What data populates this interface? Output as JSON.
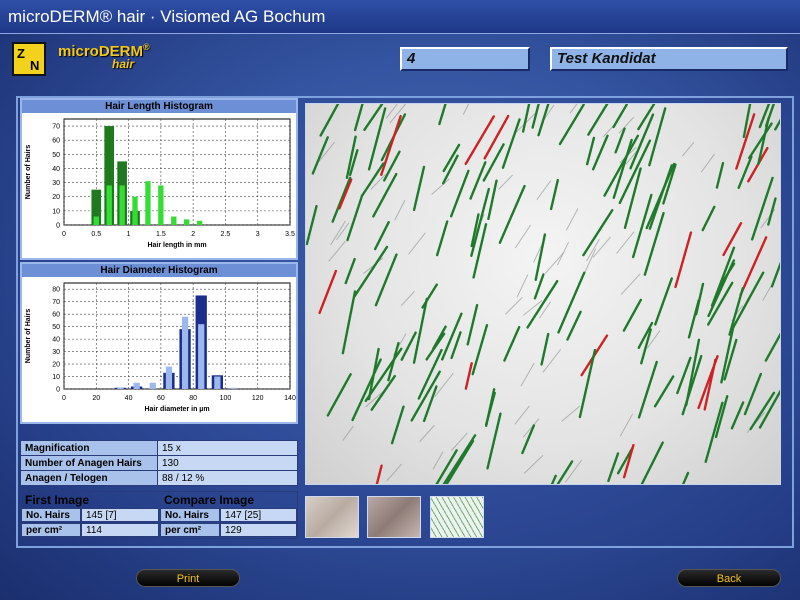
{
  "window": {
    "title": "microDERM® hair · Visiomed AG Bochum"
  },
  "logo": {
    "mark_top_left": "Z",
    "mark_bottom_right": "N",
    "name": "microDERM",
    "reg": "®",
    "sub": "hair"
  },
  "header": {
    "id_value": "4",
    "name_value": "Test Kandidat"
  },
  "length_histogram": {
    "title": "Hair Length Histogram",
    "xlabel": "Hair length in mm",
    "ylabel": "Number of Hairs",
    "xticks": [
      "0",
      "0.5",
      "1",
      "1.5",
      "2",
      "2.5",
      "3",
      "3.5"
    ],
    "yticks": [
      "0",
      "10",
      "20",
      "30",
      "40",
      "50",
      "60",
      "70"
    ]
  },
  "diameter_histogram": {
    "title": "Hair Diameter Histogram",
    "xlabel": "Hair diameter in µm",
    "ylabel": "Number of Hairs",
    "xticks": [
      "0",
      "20",
      "40",
      "60",
      "80",
      "100",
      "120",
      "140"
    ],
    "yticks": [
      "0",
      "10",
      "20",
      "30",
      "40",
      "50",
      "60",
      "70",
      "80"
    ]
  },
  "chart_data": [
    {
      "type": "bar",
      "title": "Hair Length Histogram",
      "xlabel": "Hair length in mm",
      "ylabel": "Number of Hairs",
      "xlim": [
        0,
        3.5
      ],
      "ylim": [
        0,
        75
      ],
      "bin_width": 0.15,
      "series": [
        {
          "color": "#1f7a1f",
          "x": [
            0.5,
            0.7,
            0.9,
            1.1
          ],
          "values": [
            25,
            70,
            45,
            10
          ]
        },
        {
          "color": "#33dd33",
          "x": [
            0.5,
            0.7,
            0.9,
            1.1,
            1.3,
            1.5,
            1.7,
            1.9,
            2.1
          ],
          "values": [
            6,
            28,
            28,
            20,
            31,
            28,
            6,
            4,
            3
          ]
        }
      ]
    },
    {
      "type": "bar",
      "title": "Hair Diameter Histogram",
      "xlabel": "Hair diameter in µm",
      "ylabel": "Number of Hairs",
      "xlim": [
        0,
        140
      ],
      "ylim": [
        0,
        85
      ],
      "bin_width": 7,
      "series": [
        {
          "color": "#1c2e8c",
          "x": [
            35,
            45,
            65,
            75,
            85,
            95
          ],
          "values": [
            1,
            2,
            13,
            48,
            75,
            11
          ]
        },
        {
          "color": "#9db8ee",
          "x": [
            35,
            45,
            55,
            65,
            75,
            85,
            95,
            105
          ],
          "values": [
            1,
            5,
            5,
            18,
            58,
            52,
            10,
            1
          ]
        }
      ]
    }
  ],
  "info": {
    "rows": [
      {
        "label": "Magnification",
        "value": "15 x"
      },
      {
        "label": "Number of Anagen Hairs",
        "value": "130"
      },
      {
        "label": "Anagen / Telogen",
        "value": "88 / 12  %"
      }
    ]
  },
  "compare": {
    "first_title": "First Image",
    "compare_title": "Compare Image",
    "first": {
      "hairs_label": "No. Hairs",
      "hairs_value": "145 [7]",
      "percm_label": "per cm²",
      "percm_value": "114"
    },
    "second": {
      "hairs_label": "No. Hairs",
      "hairs_value": "147 [25]",
      "percm_label": "per cm²",
      "percm_value": "129"
    }
  },
  "buttons": {
    "print": "Print",
    "back": "Back"
  },
  "colors": {
    "anagen_line": "#1e7a2a",
    "telogen_line": "#cc2222",
    "button_text": "#f1c21c"
  }
}
